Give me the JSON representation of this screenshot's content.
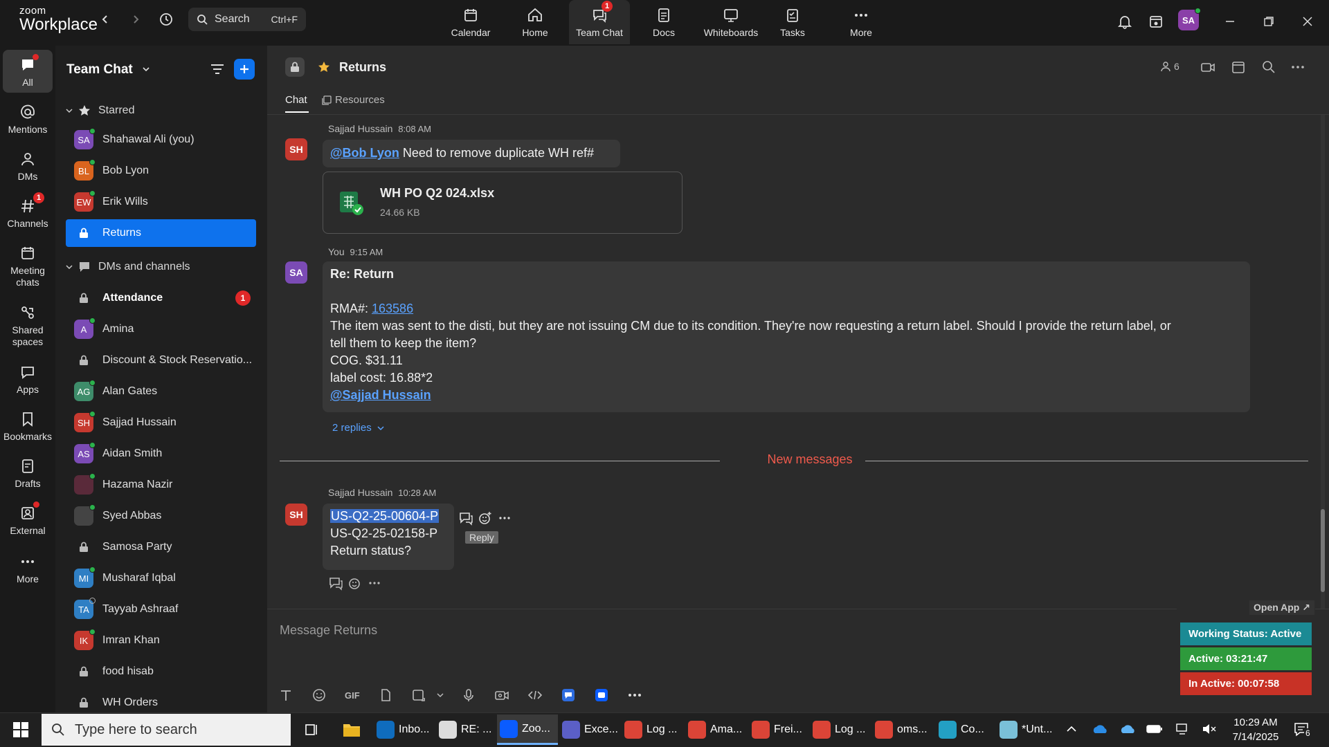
{
  "brand": {
    "line1": "zoom",
    "line2": "Workplace"
  },
  "search": {
    "label": "Search",
    "shortcut": "Ctrl+F"
  },
  "nav": [
    {
      "label": "Calendar",
      "icon": "calendar-icon"
    },
    {
      "label": "Home",
      "icon": "home-icon"
    },
    {
      "label": "Team Chat",
      "icon": "chat-icon",
      "badge": "1",
      "active": true
    },
    {
      "label": "Docs",
      "icon": "docs-icon"
    },
    {
      "label": "Whiteboards",
      "icon": "whiteboard-icon"
    },
    {
      "label": "Tasks",
      "icon": "tasks-icon"
    },
    {
      "label": "More",
      "icon": "more-icon"
    }
  ],
  "user": {
    "initials": "SA"
  },
  "rail": [
    {
      "label": "All",
      "active": true
    },
    {
      "label": "Mentions"
    },
    {
      "label": "DMs"
    },
    {
      "label": "Channels",
      "badge": "1"
    },
    {
      "label": "Meeting chats"
    },
    {
      "label": "Shared spaces"
    },
    {
      "label": "Apps"
    },
    {
      "label": "Bookmarks"
    },
    {
      "label": "Drafts"
    },
    {
      "label": "External"
    },
    {
      "label": "More"
    }
  ],
  "sidebar": {
    "title": "Team Chat",
    "starred_label": "Starred",
    "dms_label": "DMs and channels",
    "starred": [
      {
        "name": "Shahawal Ali (you)",
        "initials": "SA",
        "color": "#7b4bb5",
        "presence": "on"
      },
      {
        "name": "Bob Lyon",
        "initials": "BL",
        "color": "#d9641e",
        "presence": "on"
      },
      {
        "name": "Erik Wills",
        "initials": "EW",
        "color": "#c6392f",
        "presence": "on"
      },
      {
        "name": "Returns",
        "type": "channel",
        "selected": true
      }
    ],
    "channels": [
      {
        "name": "Attendance",
        "type": "channel",
        "bold": true,
        "badge": "1"
      },
      {
        "name": "Amina",
        "initials": "A",
        "color": "#7b4bb5",
        "presence": "on"
      },
      {
        "name": "Discount & Stock Reservatio...",
        "type": "channel"
      },
      {
        "name": "Alan Gates",
        "initials": "AG",
        "color": "#3e8c6a",
        "presence": "on"
      },
      {
        "name": "Sajjad Hussain",
        "initials": "SH",
        "color": "#c6392f",
        "presence": "on"
      },
      {
        "name": "Aidan Smith",
        "initials": "AS",
        "color": "#7b4bb5",
        "presence": "on"
      },
      {
        "name": "Hazama Nazir",
        "initials": "",
        "color": "#5a2a3a",
        "presence": "on"
      },
      {
        "name": "Syed Abbas",
        "initials": "",
        "color": "#444",
        "presence": "on"
      },
      {
        "name": "Samosa Party",
        "type": "channel"
      },
      {
        "name": "Musharaf Iqbal",
        "initials": "MI",
        "color": "#2f7fc4",
        "presence": "on"
      },
      {
        "name": "Tayyab Ashraaf",
        "initials": "TA",
        "color": "#2f7fc4",
        "presence": "off"
      },
      {
        "name": "Imran Khan",
        "initials": "IK",
        "color": "#c6392f",
        "presence": "on"
      },
      {
        "name": "food hisab",
        "type": "channel"
      },
      {
        "name": "WH Orders",
        "type": "channel"
      }
    ]
  },
  "channel": {
    "name": "Returns",
    "member_count": "6",
    "tabs": [
      {
        "label": "Chat",
        "active": true
      },
      {
        "label": "Resources"
      }
    ]
  },
  "messages": {
    "m1": {
      "sender": "Sajjad Hussain",
      "time": "8:08 AM",
      "initials": "SH",
      "mention": "@Bob Lyon",
      "text": " Need to remove duplicate WH ref#",
      "file": {
        "name": "WH PO Q2 024.xlsx",
        "size": "24.66 KB"
      }
    },
    "m2": {
      "sender": "You",
      "time": "9:15 AM",
      "initials": "SA",
      "subject": "Re: Return",
      "rma_label": "RMA#: ",
      "rma_link": "163586",
      "body1": "The item was sent to the disti, but they are not issuing CM due to its condition. They're now requesting a return label. Should I provide the return label, or",
      "body2": "tell them to keep the item?",
      "cog": "COG. $31.11",
      "label_cost": "label cost: 16.88*2",
      "mention": "@Sajjad Hussain",
      "replies": "2 replies"
    },
    "divider": "New messages",
    "m3": {
      "sender": "Sajjad Hussain",
      "time": "10:28 AM",
      "initials": "SH",
      "line1": "US-Q2-25-00604-P",
      "line2": "US-Q2-25-02158-P",
      "line3": "Return status?",
      "tooltip": "Reply"
    }
  },
  "composer": {
    "placeholder": "Message Returns",
    "gif": "GIF"
  },
  "widget": {
    "open_app": "Open App ↗",
    "status": "Working Status: Active",
    "active": "Active: 03:21:47",
    "inactive": "In Active: 00:07:58"
  },
  "taskbar": {
    "search_placeholder": "Type here to search",
    "apps": [
      {
        "label": "Inbo...",
        "color": "#0f6cbd"
      },
      {
        "label": "RE: ...",
        "color": "#dcdcdc"
      },
      {
        "label": "Zoo...",
        "color": "#0b5cff",
        "active": true
      },
      {
        "label": "Exce...",
        "color": "#5b5fc7"
      },
      {
        "label": "Log ...",
        "color": "#db4437"
      },
      {
        "label": "Ama...",
        "color": "#db4437"
      },
      {
        "label": "Frei...",
        "color": "#db4437"
      },
      {
        "label": "Log ...",
        "color": "#db4437"
      },
      {
        "label": "oms...",
        "color": "#db4437"
      },
      {
        "label": "Co...",
        "color": "#23a0c4"
      },
      {
        "label": "*Unt...",
        "color": "#7ac0d8"
      }
    ],
    "time": "10:29 AM",
    "date": "7/14/2025",
    "notifications": "6"
  }
}
